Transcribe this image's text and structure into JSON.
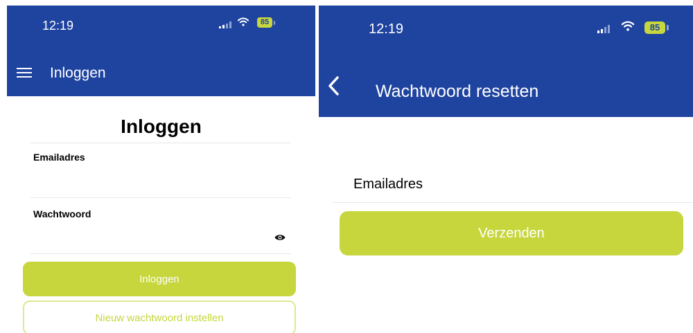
{
  "login_screen": {
    "status_bar": {
      "time": "12:19",
      "battery": "85"
    },
    "nav": {
      "title": "Inloggen"
    },
    "page_title": "Inloggen",
    "form": {
      "email_label": "Emailadres",
      "email_value": "",
      "password_label": "Wachtwoord",
      "password_value": ""
    },
    "buttons": {
      "login_label": "Inloggen",
      "new_password_label": "Nieuw wachtwoord instellen"
    }
  },
  "reset_screen": {
    "status_bar": {
      "time": "12:19",
      "battery": "85"
    },
    "nav": {
      "title": "Wachtwoord resetten"
    },
    "form": {
      "email_label": "Emailadres",
      "email_value": ""
    },
    "buttons": {
      "send_label": "Verzenden"
    }
  },
  "icons": {
    "menu": "menu-icon",
    "back": "chevron-left-icon",
    "signal": "signal-icon",
    "wifi": "wifi-icon",
    "battery": "battery-icon",
    "eye": "eye-icon"
  },
  "colors": {
    "header_background": "#1f44a0",
    "accent": "#c6d63c",
    "text": "#000000",
    "divider": "#e6e6e6"
  }
}
